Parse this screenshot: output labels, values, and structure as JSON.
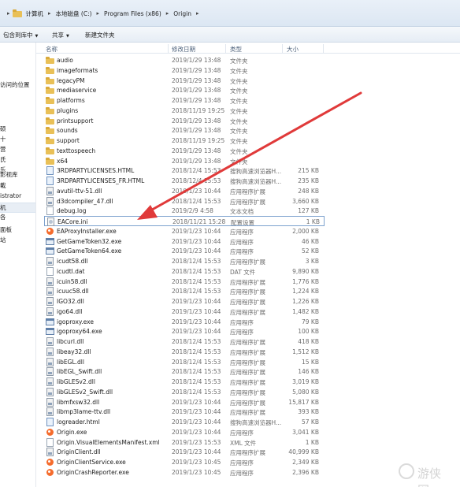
{
  "address": {
    "crumbs": [
      "计算机",
      "本地磁盘 (C:)",
      "Program Files (x86)",
      "Origin"
    ]
  },
  "toolbar": {
    "include_in_library": "包含到库中",
    "share": "共享",
    "new_folder": "新建文件夹"
  },
  "nav": {
    "items": [
      "访问的位置",
      "",
      "",
      "",
      "",
      "",
      "影视库",
      "",
      "istrator",
      "机",
      "",
      "面板",
      "站"
    ]
  },
  "columns": {
    "name": "名称",
    "date": "修改日期",
    "type": "类型",
    "size": "大小"
  },
  "files": [
    {
      "name": "audio",
      "date": "2019/1/29 13:48",
      "type": "文件夹",
      "size": "",
      "icon": "folder"
    },
    {
      "name": "imageformats",
      "date": "2019/1/29 13:48",
      "type": "文件夹",
      "size": "",
      "icon": "folder"
    },
    {
      "name": "legacyPM",
      "date": "2019/1/29 13:48",
      "type": "文件夹",
      "size": "",
      "icon": "folder"
    },
    {
      "name": "mediaservice",
      "date": "2019/1/29 13:48",
      "type": "文件夹",
      "size": "",
      "icon": "folder"
    },
    {
      "name": "platforms",
      "date": "2019/1/29 13:48",
      "type": "文件夹",
      "size": "",
      "icon": "folder"
    },
    {
      "name": "plugins",
      "date": "2018/11/19 19:25",
      "type": "文件夹",
      "size": "",
      "icon": "folder"
    },
    {
      "name": "printsupport",
      "date": "2019/1/29 13:48",
      "type": "文件夹",
      "size": "",
      "icon": "folder"
    },
    {
      "name": "sounds",
      "date": "2019/1/29 13:48",
      "type": "文件夹",
      "size": "",
      "icon": "folder"
    },
    {
      "name": "support",
      "date": "2018/11/19 19:25",
      "type": "文件夹",
      "size": "",
      "icon": "folder"
    },
    {
      "name": "texttospeech",
      "date": "2019/1/29 13:48",
      "type": "文件夹",
      "size": "",
      "icon": "folder"
    },
    {
      "name": "x64",
      "date": "2019/1/29 13:48",
      "type": "文件夹",
      "size": "",
      "icon": "folder"
    },
    {
      "name": "3RDPARTYLICENSES.HTML",
      "date": "2018/12/4 15:53",
      "type": "搜狗高速浏览器H...",
      "size": "215 KB",
      "icon": "html"
    },
    {
      "name": "3RDPARTYLICENSES_FR.HTML",
      "date": "2018/12/4 15:53",
      "type": "搜狗高速浏览器H...",
      "size": "235 KB",
      "icon": "html"
    },
    {
      "name": "avutil-ttv-51.dll",
      "date": "2019/1/23 10:44",
      "type": "应用程序扩展",
      "size": "248 KB",
      "icon": "dll"
    },
    {
      "name": "d3dcompiler_47.dll",
      "date": "2018/12/4 15:53",
      "type": "应用程序扩展",
      "size": "3,660 KB",
      "icon": "dll"
    },
    {
      "name": "debug.log",
      "date": "2019/2/9 4:58",
      "type": "文本文档",
      "size": "127 KB",
      "icon": "doc"
    },
    {
      "name": "EACore.ini",
      "date": "2018/11/21 15:28",
      "type": "配置设置",
      "size": "1 KB",
      "icon": "ini"
    },
    {
      "name": "EAProxyInstaller.exe",
      "date": "2019/1/23 10:44",
      "type": "应用程序",
      "size": "2,000 KB",
      "icon": "origin"
    },
    {
      "name": "GetGameToken32.exe",
      "date": "2019/1/23 10:44",
      "type": "应用程序",
      "size": "46 KB",
      "icon": "exe"
    },
    {
      "name": "GetGameToken64.exe",
      "date": "2019/1/23 10:44",
      "type": "应用程序",
      "size": "52 KB",
      "icon": "exe"
    },
    {
      "name": "icudt58.dll",
      "date": "2018/12/4 15:53",
      "type": "应用程序扩展",
      "size": "3 KB",
      "icon": "dll"
    },
    {
      "name": "icudtl.dat",
      "date": "2018/12/4 15:53",
      "type": "DAT 文件",
      "size": "9,890 KB",
      "icon": "doc"
    },
    {
      "name": "icuin58.dll",
      "date": "2018/12/4 15:53",
      "type": "应用程序扩展",
      "size": "1,776 KB",
      "icon": "dll"
    },
    {
      "name": "icuuc58.dll",
      "date": "2018/12/4 15:53",
      "type": "应用程序扩展",
      "size": "1,224 KB",
      "icon": "dll"
    },
    {
      "name": "IGO32.dll",
      "date": "2019/1/23 10:44",
      "type": "应用程序扩展",
      "size": "1,226 KB",
      "icon": "dll"
    },
    {
      "name": "igo64.dll",
      "date": "2019/1/23 10:44",
      "type": "应用程序扩展",
      "size": "1,482 KB",
      "icon": "dll"
    },
    {
      "name": "igoproxy.exe",
      "date": "2019/1/23 10:44",
      "type": "应用程序",
      "size": "79 KB",
      "icon": "exe"
    },
    {
      "name": "igoproxy64.exe",
      "date": "2019/1/23 10:44",
      "type": "应用程序",
      "size": "100 KB",
      "icon": "exe"
    },
    {
      "name": "libcurl.dll",
      "date": "2018/12/4 15:53",
      "type": "应用程序扩展",
      "size": "418 KB",
      "icon": "dll"
    },
    {
      "name": "libeay32.dll",
      "date": "2018/12/4 15:53",
      "type": "应用程序扩展",
      "size": "1,512 KB",
      "icon": "dll"
    },
    {
      "name": "libEGL.dll",
      "date": "2018/12/4 15:53",
      "type": "应用程序扩展",
      "size": "15 KB",
      "icon": "dll"
    },
    {
      "name": "libEGL_Swift.dll",
      "date": "2018/12/4 15:53",
      "type": "应用程序扩展",
      "size": "146 KB",
      "icon": "dll"
    },
    {
      "name": "libGLESv2.dll",
      "date": "2018/12/4 15:53",
      "type": "应用程序扩展",
      "size": "3,019 KB",
      "icon": "dll"
    },
    {
      "name": "libGLESv2_Swift.dll",
      "date": "2018/12/4 15:53",
      "type": "应用程序扩展",
      "size": "5,080 KB",
      "icon": "dll"
    },
    {
      "name": "libmfxsw32.dll",
      "date": "2019/1/23 10:44",
      "type": "应用程序扩展",
      "size": "15,817 KB",
      "icon": "dll"
    },
    {
      "name": "libmp3lame-ttv.dll",
      "date": "2019/1/23 10:44",
      "type": "应用程序扩展",
      "size": "393 KB",
      "icon": "dll"
    },
    {
      "name": "logreader.html",
      "date": "2019/1/23 10:44",
      "type": "搜狗高速浏览器H...",
      "size": "57 KB",
      "icon": "html"
    },
    {
      "name": "Origin.exe",
      "date": "2019/1/23 10:44",
      "type": "应用程序",
      "size": "3,041 KB",
      "icon": "origin"
    },
    {
      "name": "Origin.VisualElementsManifest.xml",
      "date": "2019/1/23 15:53",
      "type": "XML 文件",
      "size": "1 KB",
      "icon": "doc"
    },
    {
      "name": "OriginClient.dll",
      "date": "2019/1/23 10:44",
      "type": "应用程序扩展",
      "size": "40,999 KB",
      "icon": "dll"
    },
    {
      "name": "OriginClientService.exe",
      "date": "2019/1/23 10:45",
      "type": "应用程序",
      "size": "2,349 KB",
      "icon": "origin"
    },
    {
      "name": "OriginCrashReporter.exe",
      "date": "2019/1/23 10:45",
      "type": "应用程序",
      "size": "2,396 KB",
      "icon": "origin"
    }
  ],
  "selected_file": "EACore.ini",
  "annotation": {
    "arrow_color": "#e03a3a"
  },
  "watermark": {
    "text": "游侠网"
  }
}
